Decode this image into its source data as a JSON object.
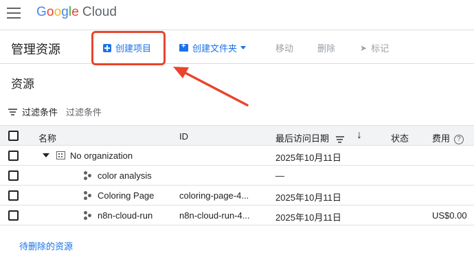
{
  "header": {
    "logo_google": [
      "G",
      "o",
      "o",
      "g",
      "l",
      "e"
    ],
    "logo_cloud": "Cloud"
  },
  "toolbar": {
    "title": "管理资源",
    "create_project": "创建项目",
    "create_folder": "创建文件夹",
    "move": "移动",
    "delete": "删除",
    "label": "标记"
  },
  "section": {
    "title": "资源",
    "filter_label": "过滤条件",
    "filter_placeholder": "过滤条件"
  },
  "table": {
    "columns": {
      "name": "名称",
      "id": "ID",
      "last_accessed": "最后访问日期",
      "status": "状态",
      "cost": "费用"
    },
    "rows": [
      {
        "name": "No organization",
        "id": "",
        "last_accessed": "2025年10月11日",
        "status": "",
        "cost": ""
      },
      {
        "name": "color analysis",
        "id": "",
        "last_accessed": "—",
        "status": "",
        "cost": ""
      },
      {
        "name": "Coloring Page",
        "id": "coloring-page-4...",
        "last_accessed": "2025年10月11日",
        "status": "",
        "cost": ""
      },
      {
        "name": "n8n-cloud-run",
        "id": "n8n-cloud-run-4...",
        "last_accessed": "2025年10月11日",
        "status": "",
        "cost": "US$0.00"
      }
    ]
  },
  "footer": {
    "pending_deletion": "待删除的资源"
  },
  "colors": {
    "accent": "#1a73e8",
    "annotation": "#e8452c"
  }
}
